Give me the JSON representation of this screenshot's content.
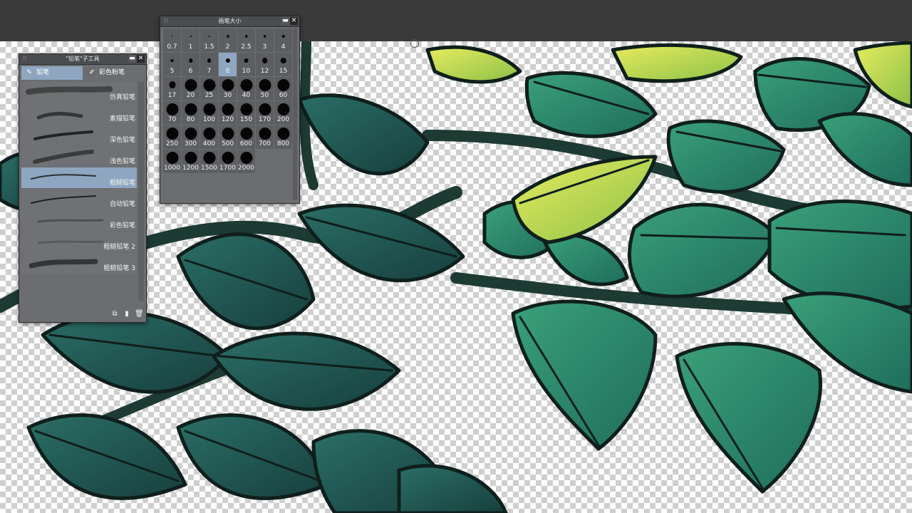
{
  "size_panel": {
    "title": "画笔大小",
    "sizes": [
      "0.7",
      "1",
      "1.5",
      "2",
      "2.5",
      "3",
      "4",
      "5",
      "6",
      "7",
      "8",
      "10",
      "12",
      "15",
      "17",
      "20",
      "25",
      "30",
      "40",
      "50",
      "60",
      "70",
      "80",
      "100",
      "120",
      "150",
      "170",
      "200",
      "250",
      "300",
      "400",
      "500",
      "600",
      "700",
      "800",
      "1000",
      "1200",
      "1500",
      "1700",
      "2000"
    ],
    "selected": "8"
  },
  "tool_panel": {
    "title": "\"铅笔\"子工具",
    "tabs": [
      {
        "label": "铅笔",
        "icon": "pencil-icon",
        "active": true
      },
      {
        "label": "彩色粉笔",
        "icon": "pastel-icon",
        "active": false
      }
    ],
    "brushes": [
      {
        "label": "仿真铅笔"
      },
      {
        "label": "素描铅笔"
      },
      {
        "label": "深色铅笔"
      },
      {
        "label": "浅色铅笔"
      },
      {
        "label": "粗糙铅笔",
        "selected": true
      },
      {
        "label": "自动铅笔"
      },
      {
        "label": "彩色铅笔"
      },
      {
        "label": "粗糙铅笔 2"
      },
      {
        "label": "粗糙铅笔 3"
      }
    ],
    "footer_icons": [
      "duplicate-icon",
      "new-subtool-icon",
      "delete-icon"
    ]
  },
  "colors": {
    "selection": "#8ea6c0",
    "panel": "#6b6d70",
    "leaf_dark": "#1e5a52",
    "leaf_mid": "#2f8a6c",
    "leaf_light": "#cfe15a"
  }
}
